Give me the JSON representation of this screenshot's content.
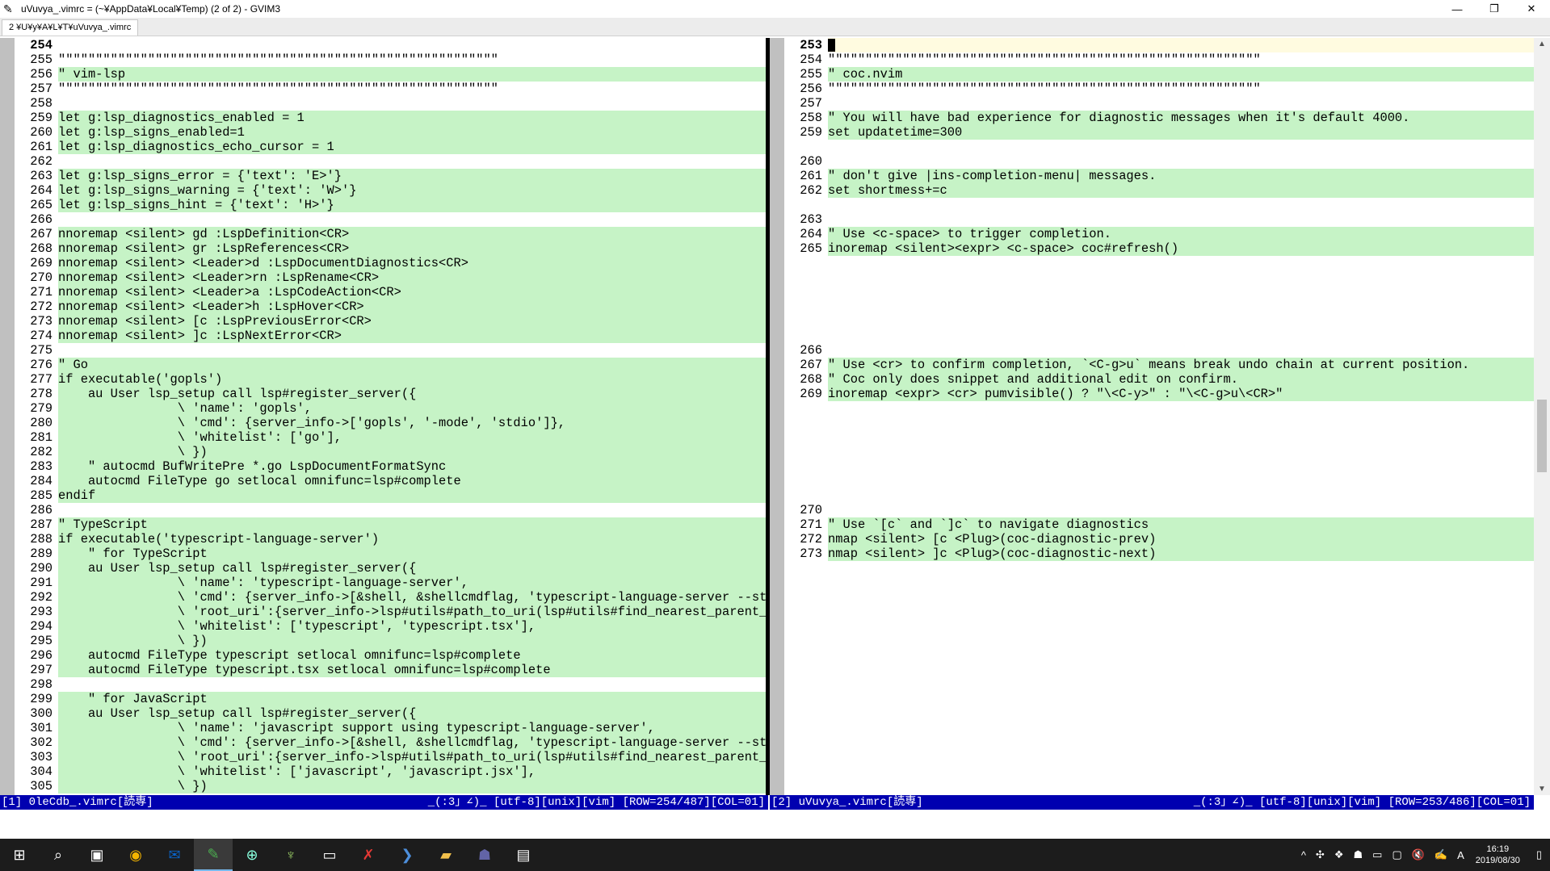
{
  "window": {
    "title": "uVuvya_.vimrc = (~¥AppData¥Local¥Temp) (2 of 2) - GVIM3",
    "tab_label": "2 ¥U¥y¥A¥L¥T¥uVuvya_.vimrc"
  },
  "colors": {
    "added": "#c6f3c6",
    "deleted": "#ffc8c8",
    "statusline": "#0000b0"
  },
  "left": {
    "rows": [
      {
        "n": "254",
        "t": "cur",
        "c": ""
      },
      {
        "n": "255",
        "t": "plain",
        "c": "\"\"\"\"\"\"\"\"\"\"\"\"\"\"\"\"\"\"\"\"\"\"\"\"\"\"\"\"\"\"\"\"\"\"\"\"\"\"\"\"\"\"\"\"\"\"\"\"\"\"\"\"\"\"\"\"\"\"\""
      },
      {
        "n": "256",
        "t": "add",
        "c": "\" vim-lsp"
      },
      {
        "n": "257",
        "t": "plain",
        "c": "\"\"\"\"\"\"\"\"\"\"\"\"\"\"\"\"\"\"\"\"\"\"\"\"\"\"\"\"\"\"\"\"\"\"\"\"\"\"\"\"\"\"\"\"\"\"\"\"\"\"\"\"\"\"\"\"\"\"\""
      },
      {
        "n": "258",
        "t": "plain",
        "c": ""
      },
      {
        "n": "259",
        "t": "add",
        "c": "let g:lsp_diagnostics_enabled = 1"
      },
      {
        "n": "260",
        "t": "add",
        "c": "let g:lsp_signs_enabled=1"
      },
      {
        "n": "261",
        "t": "add",
        "c": "let g:lsp_diagnostics_echo_cursor = 1"
      },
      {
        "n": "262",
        "t": "plain",
        "c": ""
      },
      {
        "n": "263",
        "t": "add",
        "c": "let g:lsp_signs_error = {'text': 'E>'}"
      },
      {
        "n": "264",
        "t": "add",
        "c": "let g:lsp_signs_warning = {'text': 'W>'}"
      },
      {
        "n": "265",
        "t": "add",
        "c": "let g:lsp_signs_hint = {'text': 'H>'}"
      },
      {
        "n": "266",
        "t": "plain",
        "c": ""
      },
      {
        "n": "267",
        "t": "add",
        "c": "nnoremap <silent> gd :LspDefinition<CR>"
      },
      {
        "n": "268",
        "t": "add",
        "c": "nnoremap <silent> gr :LspReferences<CR>"
      },
      {
        "n": "269",
        "t": "add",
        "c": "nnoremap <silent> <Leader>d :LspDocumentDiagnostics<CR>"
      },
      {
        "n": "270",
        "t": "add",
        "c": "nnoremap <silent> <Leader>rn :LspRename<CR>"
      },
      {
        "n": "271",
        "t": "add",
        "c": "nnoremap <silent> <Leader>a :LspCodeAction<CR>"
      },
      {
        "n": "272",
        "t": "add",
        "c": "nnoremap <silent> <Leader>h :LspHover<CR>"
      },
      {
        "n": "273",
        "t": "add",
        "c": "nnoremap <silent> [c :LspPreviousError<CR>"
      },
      {
        "n": "274",
        "t": "add",
        "c": "nnoremap <silent> ]c :LspNextError<CR>"
      },
      {
        "n": "275",
        "t": "plain",
        "c": ""
      },
      {
        "n": "276",
        "t": "add",
        "c": "\" Go"
      },
      {
        "n": "277",
        "t": "add",
        "c": "if executable('gopls')"
      },
      {
        "n": "278",
        "t": "add",
        "c": "    au User lsp_setup call lsp#register_server({"
      },
      {
        "n": "279",
        "t": "add",
        "c": "                \\ 'name': 'gopls',"
      },
      {
        "n": "280",
        "t": "add",
        "c": "                \\ 'cmd': {server_info->['gopls', '-mode', 'stdio']},"
      },
      {
        "n": "281",
        "t": "add",
        "c": "                \\ 'whitelist': ['go'],"
      },
      {
        "n": "282",
        "t": "add",
        "c": "                \\ })"
      },
      {
        "n": "283",
        "t": "add",
        "c": "    \" autocmd BufWritePre *.go LspDocumentFormatSync"
      },
      {
        "n": "284",
        "t": "add",
        "c": "    autocmd FileType go setlocal omnifunc=lsp#complete"
      },
      {
        "n": "285",
        "t": "add",
        "c": "endif"
      },
      {
        "n": "286",
        "t": "plain",
        "c": ""
      },
      {
        "n": "287",
        "t": "add",
        "c": "\" TypeScript"
      },
      {
        "n": "288",
        "t": "add",
        "c": "if executable('typescript-language-server')"
      },
      {
        "n": "289",
        "t": "add",
        "c": "    \" for TypeScript"
      },
      {
        "n": "290",
        "t": "add",
        "c": "    au User lsp_setup call lsp#register_server({"
      },
      {
        "n": "291",
        "t": "add",
        "c": "                \\ 'name': 'typescript-language-server',"
      },
      {
        "n": "292",
        "t": "add",
        "c": "                \\ 'cmd': {server_info->[&shell, &shellcmdflag, 'typescript-language-server --stdi"
      },
      {
        "n": "293",
        "t": "add",
        "c": "                \\ 'root_uri':{server_info->lsp#utils#path_to_uri(lsp#utils#find_nearest_parent_fi"
      },
      {
        "n": "294",
        "t": "add",
        "c": "                \\ 'whitelist': ['typescript', 'typescript.tsx'],"
      },
      {
        "n": "295",
        "t": "add",
        "c": "                \\ })"
      },
      {
        "n": "296",
        "t": "add",
        "c": "    autocmd FileType typescript setlocal omnifunc=lsp#complete"
      },
      {
        "n": "297",
        "t": "add",
        "c": "    autocmd FileType typescript.tsx setlocal omnifunc=lsp#complete"
      },
      {
        "n": "298",
        "t": "add",
        "c": ""
      },
      {
        "n": "299",
        "t": "add",
        "c": "    \" for JavaScript"
      },
      {
        "n": "300",
        "t": "add",
        "c": "    au User lsp_setup call lsp#register_server({"
      },
      {
        "n": "301",
        "t": "add",
        "c": "                \\ 'name': 'javascript support using typescript-language-server',"
      },
      {
        "n": "302",
        "t": "add",
        "c": "                \\ 'cmd': {server_info->[&shell, &shellcmdflag, 'typescript-language-server --stdi"
      },
      {
        "n": "303",
        "t": "add",
        "c": "                \\ 'root_uri':{server_info->lsp#utils#path_to_uri(lsp#utils#find_nearest_parent_fi"
      },
      {
        "n": "304",
        "t": "add",
        "c": "                \\ 'whitelist': ['javascript', 'javascript.jsx'],"
      },
      {
        "n": "305",
        "t": "add",
        "c": "                \\ })"
      }
    ]
  },
  "right": {
    "rows": [
      {
        "n": "253",
        "t": "cur",
        "c": "",
        "cursor": true
      },
      {
        "n": "254",
        "t": "plain",
        "c": "\"\"\"\"\"\"\"\"\"\"\"\"\"\"\"\"\"\"\"\"\"\"\"\"\"\"\"\"\"\"\"\"\"\"\"\"\"\"\"\"\"\"\"\"\"\"\"\"\"\"\"\"\"\"\"\"\"\""
      },
      {
        "n": "255",
        "t": "add",
        "c": "\" coc.nvim"
      },
      {
        "n": "256",
        "t": "plain",
        "c": "\"\"\"\"\"\"\"\"\"\"\"\"\"\"\"\"\"\"\"\"\"\"\"\"\"\"\"\"\"\"\"\"\"\"\"\"\"\"\"\"\"\"\"\"\"\"\"\"\"\"\"\"\"\"\"\"\"\""
      },
      {
        "n": "257",
        "t": "plain",
        "c": ""
      },
      {
        "n": "258",
        "t": "add",
        "c": "\" You will have bad experience for diagnostic messages when it's default 4000."
      },
      {
        "n": "259",
        "t": "add",
        "c": "set updatetime=300"
      },
      {
        "n": "",
        "t": "filler",
        "c": ""
      },
      {
        "n": "260",
        "t": "plain",
        "c": ""
      },
      {
        "n": "261",
        "t": "add",
        "c": "\" don't give |ins-completion-menu| messages."
      },
      {
        "n": "262",
        "t": "add",
        "c": "set shortmess+=c"
      },
      {
        "n": "",
        "t": "filler",
        "c": ""
      },
      {
        "n": "263",
        "t": "plain",
        "c": ""
      },
      {
        "n": "264",
        "t": "add",
        "c": "\" Use <c-space> to trigger completion."
      },
      {
        "n": "265",
        "t": "add",
        "c": "inoremap <silent><expr> <c-space> coc#refresh()"
      },
      {
        "n": "",
        "t": "filler",
        "c": ""
      },
      {
        "n": "",
        "t": "filler",
        "c": ""
      },
      {
        "n": "",
        "t": "filler",
        "c": ""
      },
      {
        "n": "",
        "t": "filler",
        "c": ""
      },
      {
        "n": "",
        "t": "filler",
        "c": ""
      },
      {
        "n": "",
        "t": "filler",
        "c": ""
      },
      {
        "n": "266",
        "t": "plain",
        "c": ""
      },
      {
        "n": "267",
        "t": "add",
        "c": "\" Use <cr> to confirm completion, `<C-g>u` means break undo chain at current position."
      },
      {
        "n": "268",
        "t": "add",
        "c": "\" Coc only does snippet and additional edit on confirm."
      },
      {
        "n": "269",
        "t": "add",
        "c": "inoremap <expr> <cr> pumvisible() ? \"\\<C-y>\" : \"\\<C-g>u\\<CR>\""
      },
      {
        "n": "",
        "t": "filler",
        "c": ""
      },
      {
        "n": "",
        "t": "filler",
        "c": ""
      },
      {
        "n": "",
        "t": "filler",
        "c": ""
      },
      {
        "n": "",
        "t": "filler",
        "c": ""
      },
      {
        "n": "",
        "t": "filler",
        "c": ""
      },
      {
        "n": "",
        "t": "filler",
        "c": ""
      },
      {
        "n": "",
        "t": "filler",
        "c": ""
      },
      {
        "n": "270",
        "t": "plain",
        "c": ""
      },
      {
        "n": "271",
        "t": "add",
        "c": "\" Use `[c` and `]c` to navigate diagnostics"
      },
      {
        "n": "272",
        "t": "add",
        "c": "nmap <silent> [c <Plug>(coc-diagnostic-prev)"
      },
      {
        "n": "273",
        "t": "add",
        "c": "nmap <silent> ]c <Plug>(coc-diagnostic-next)"
      },
      {
        "n": "",
        "t": "filler",
        "c": ""
      },
      {
        "n": "",
        "t": "filler",
        "c": ""
      },
      {
        "n": "",
        "t": "filler",
        "c": ""
      },
      {
        "n": "",
        "t": "filler",
        "c": ""
      },
      {
        "n": "",
        "t": "filler",
        "c": ""
      },
      {
        "n": "",
        "t": "filler",
        "c": ""
      },
      {
        "n": "",
        "t": "filler",
        "c": ""
      },
      {
        "n": "",
        "t": "filler",
        "c": ""
      },
      {
        "n": "",
        "t": "filler",
        "c": ""
      },
      {
        "n": "",
        "t": "filler",
        "c": ""
      },
      {
        "n": "",
        "t": "filler",
        "c": ""
      },
      {
        "n": "",
        "t": "filler",
        "c": ""
      },
      {
        "n": "",
        "t": "filler",
        "c": ""
      },
      {
        "n": "",
        "t": "filler",
        "c": ""
      },
      {
        "n": "",
        "t": "filler",
        "c": ""
      },
      {
        "n": "",
        "t": "filler",
        "c": ""
      }
    ]
  },
  "status": {
    "left_name": "[1] 0leCdb_.vimrc[読専]",
    "left_info": "_(:3」∠)_ [utf-8][unix][vim] [ROW=254/487][COL=01]",
    "right_name": "[2] uVuvya_.vimrc[読専]",
    "right_info": "_(:3」∠)_ [utf-8][unix][vim] [ROW=253/486][COL=01]"
  },
  "taskbar": {
    "time": "16:19",
    "date": "2019/08/30",
    "ime": "A"
  }
}
